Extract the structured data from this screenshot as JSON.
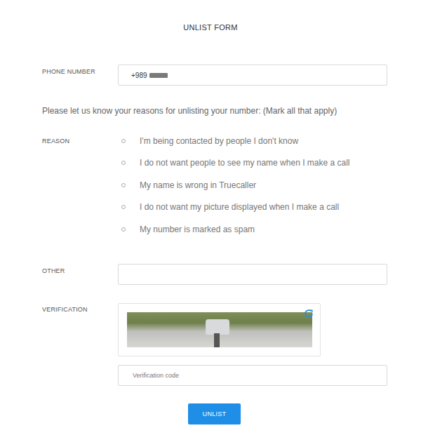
{
  "title": "UNLIST FORM",
  "phone": {
    "label": "PHONE NUMBER",
    "value": "+989"
  },
  "prompt": "Please let us know your reasons for unlisting your number: (Mark all that apply)",
  "reasons": {
    "label": "REASON",
    "options": [
      {
        "label": "I'm being contacted by people I don't know",
        "checked": false
      },
      {
        "label": "I do not want people to see my name when I make a call",
        "checked": false
      },
      {
        "label": "My name is wrong in Truecaller",
        "checked": false
      },
      {
        "label": "I do not want my picture displayed when I make a call",
        "checked": false
      },
      {
        "label": "My number is marked as spam",
        "checked": false
      }
    ]
  },
  "other": {
    "label": "OTHER",
    "value": ""
  },
  "verification": {
    "label": "VERIFICATION",
    "placeholder": "Verification code"
  },
  "button": "UNLIST"
}
